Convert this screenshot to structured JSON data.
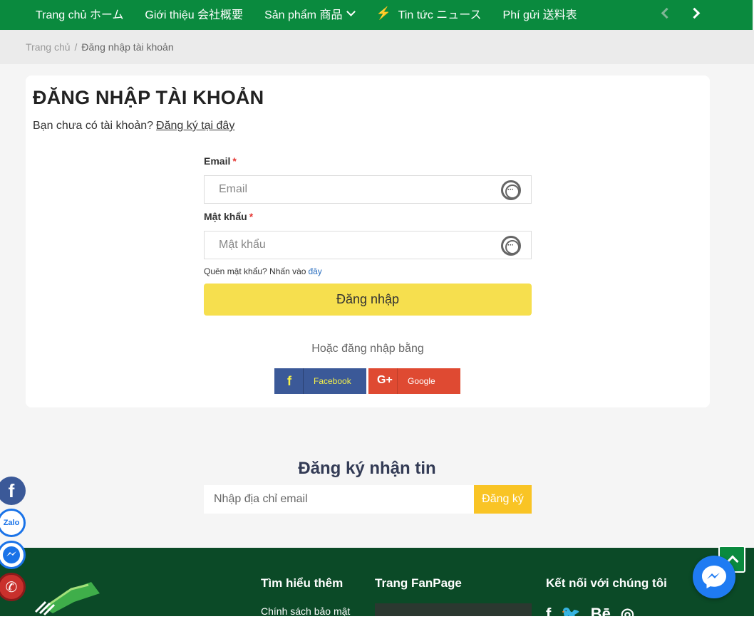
{
  "nav": {
    "items": [
      {
        "label": "Trang chủ ホーム"
      },
      {
        "label": "Giới thiệu 会社概要"
      },
      {
        "label": "Sản phẩm 商品"
      },
      {
        "label": "Tin tức ニュース"
      },
      {
        "label": "Phí gửi 送料表"
      }
    ],
    "accent_color": "#0a8a3e"
  },
  "breadcrumb": {
    "home": "Trang chủ",
    "separator": "/",
    "current": "Đăng nhập tài khoản"
  },
  "login": {
    "title": "ĐĂNG NHẬP TÀI KHOẢN",
    "no_account_text": "Bạn chưa có tài khoản?",
    "register_link": "Đăng ký tại đây",
    "email_label": "Email",
    "email_placeholder": "Email",
    "password_label": "Mật khẩu",
    "password_placeholder": "Mật khẩu",
    "required_mark": "*",
    "forgot_text": "Quên mật khẩu? Nhấn vào",
    "forgot_link": "đây",
    "submit_label": "Đăng nhập",
    "or_text": "Hoặc đăng nhập bằng",
    "facebook_label": "Facebook",
    "google_label": "Google"
  },
  "newsletter": {
    "title": "Đăng ký nhận tin",
    "placeholder": "Nhập địa chỉ email",
    "button_label": "Đăng ký"
  },
  "footer": {
    "col1_title": "Tìm hiểu thêm",
    "col1_link": "Chính sách bảo mật",
    "col2_title": "Trang FanPage",
    "col3_title": "Kết nối với chúng tôi"
  },
  "floating": {
    "zalo_label": "Zalo"
  }
}
